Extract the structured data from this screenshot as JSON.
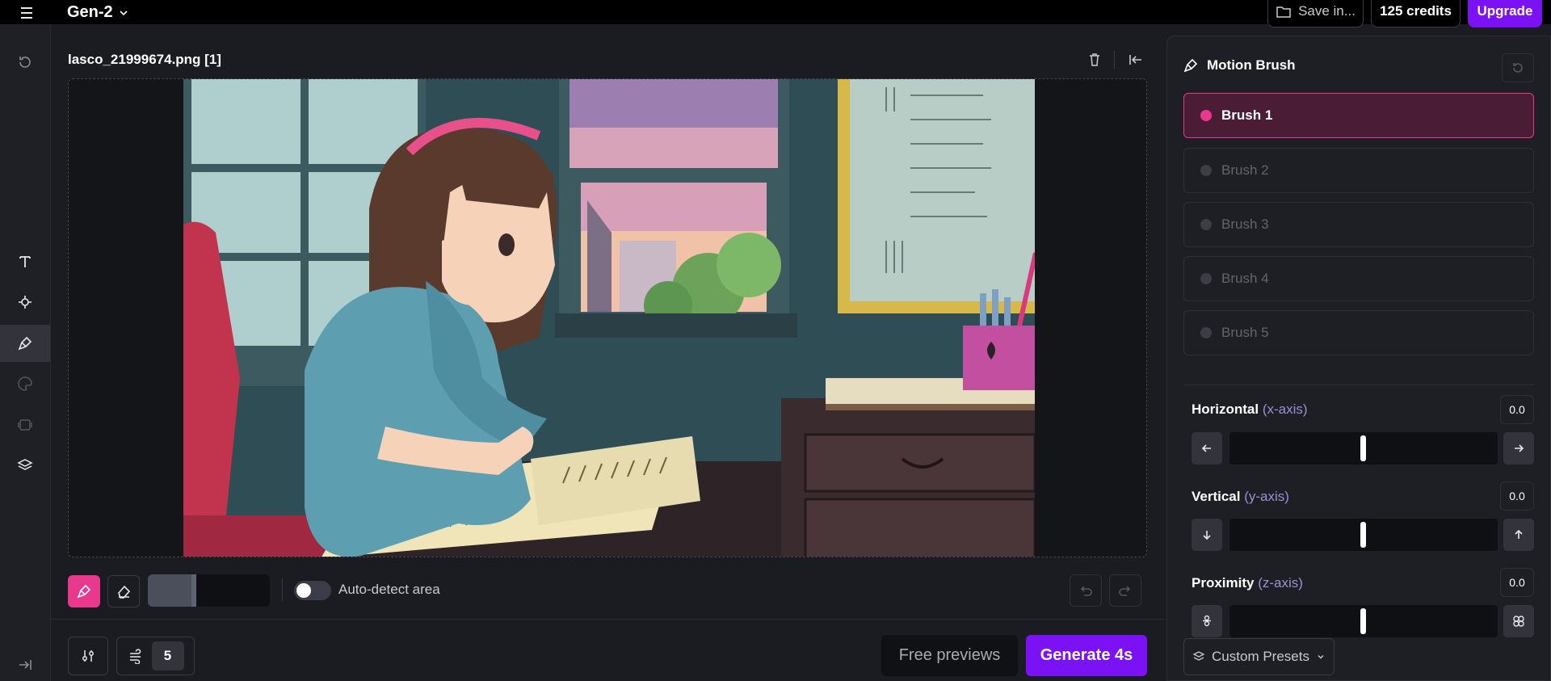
{
  "app": {
    "title": "Gen-2"
  },
  "topbar": {
    "save_label": "Save in...",
    "credits_label": "125 credits",
    "upgrade_label": "Upgrade"
  },
  "canvas": {
    "filename": "lasco_21999674.png [1]"
  },
  "tools": {
    "auto_detect_label": "Auto-detect area",
    "auto_detect_on": false,
    "brush_size_fraction": 0.4
  },
  "footer": {
    "motion_count": "5",
    "preview_label": "Free previews",
    "generate_label": "Generate 4s"
  },
  "panel": {
    "title": "Motion Brush",
    "brushes": [
      {
        "label": "Brush 1",
        "active": true
      },
      {
        "label": "Brush 2",
        "active": false
      },
      {
        "label": "Brush 3",
        "active": false
      },
      {
        "label": "Brush 4",
        "active": false
      },
      {
        "label": "Brush 5",
        "active": false
      }
    ],
    "axes": [
      {
        "label": "Horizontal",
        "hint": "(x-axis)",
        "value": "0.0"
      },
      {
        "label": "Vertical",
        "hint": "(y-axis)",
        "value": "0.0"
      },
      {
        "label": "Proximity",
        "hint": "(z-axis)",
        "value": "0.0"
      }
    ],
    "presets_label": "Custom Presets"
  },
  "colors": {
    "accent_purple": "#7a12f5",
    "brush_pink": "#e8398f",
    "active_brush_bg": "#4a1c36"
  },
  "icons": [
    "menu-icon",
    "chevron-down-icon",
    "folder-icon",
    "history-icon",
    "text-icon",
    "camera-motion-icon",
    "motion-brush-icon",
    "palette-icon",
    "frames-icon",
    "layers-icon",
    "expand-icon",
    "trash-icon",
    "collapse-panel-icon",
    "brush-icon",
    "eraser-icon",
    "undo-icon",
    "redo-icon",
    "sliders-icon",
    "wind-icon",
    "reset-icon",
    "arrow-left-icon",
    "arrow-right-icon",
    "arrow-down-icon",
    "arrow-up-icon",
    "zoom-in-icon",
    "zoom-out-icon",
    "stack-icon"
  ]
}
